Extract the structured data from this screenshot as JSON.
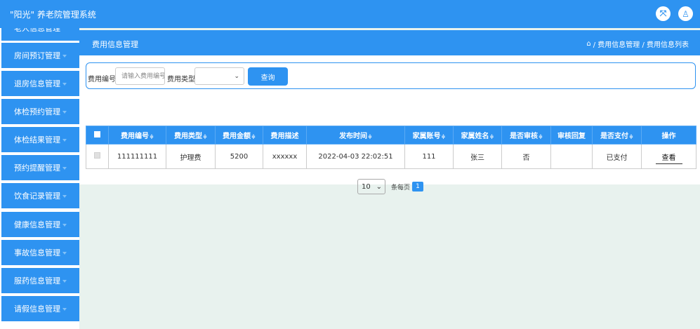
{
  "app": {
    "title": "\"阳光\" 养老院管理系统"
  },
  "topbar": {
    "fullscreen_icon": "⤧",
    "user_icon": "♙"
  },
  "sidebar": {
    "items": [
      {
        "label": "老人信息管理"
      },
      {
        "label": "房间预订管理"
      },
      {
        "label": "退房信息管理"
      },
      {
        "label": "体检预约管理"
      },
      {
        "label": "体检结果管理"
      },
      {
        "label": "预约提醒管理"
      },
      {
        "label": "饮食记录管理"
      },
      {
        "label": "健康信息管理"
      },
      {
        "label": "事故信息管理"
      },
      {
        "label": "服药信息管理"
      },
      {
        "label": "请假信息管理"
      }
    ]
  },
  "header": {
    "title": "费用信息管理",
    "breadcrumb": {
      "home_icon": "⌂",
      "text": "/ 费用信息管理 / 费用信息列表"
    }
  },
  "search": {
    "code_label": "费用编号",
    "code_placeholder": "请输入费用编号",
    "type_label": "费用类型",
    "type_value": "",
    "query_button": "查询"
  },
  "table": {
    "sort_icon": "≑",
    "columns": [
      "费用编号",
      "费用类型",
      "费用金额",
      "费用描述",
      "发布时间",
      "家属账号",
      "家属姓名",
      "是否审核",
      "审核回复",
      "是否支付",
      "操作"
    ],
    "rows": [
      {
        "code": "111111111",
        "type": "护理费",
        "amount": "5200",
        "desc": "xxxxxx",
        "time": "2022-04-03 22:02:51",
        "account": "111",
        "name": "张三",
        "reviewed": "否",
        "reply": "",
        "paid": "已支付",
        "action": "查看"
      }
    ]
  },
  "pagination": {
    "page_size": "10",
    "per_page_label": "条每页",
    "current_page": "1"
  }
}
